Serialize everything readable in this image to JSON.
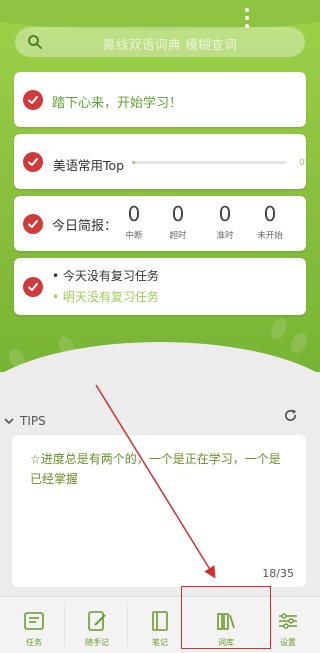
{
  "search": {
    "placeholder": "离线双语词典 模糊查词"
  },
  "cards": {
    "start": {
      "text": "踏下心来，开始学习！"
    },
    "progress": {
      "book": "美语常用Top",
      "percent_label": "0%",
      "progress": 0
    },
    "summary": {
      "title": "今日简报：",
      "stats": [
        {
          "value": "0",
          "label": "中断"
        },
        {
          "value": "0",
          "label": "超时"
        },
        {
          "value": "0",
          "label": "准时"
        },
        {
          "value": "0",
          "label": "未开始"
        }
      ]
    },
    "review": {
      "line1": "• 今天没有复习任务",
      "line2": "• 明天没有复习任务"
    }
  },
  "tips": {
    "header": "TIPS",
    "text": "☆进度总是有两个的，一个是正在学习，一个是已经掌握",
    "counter": "18/35"
  },
  "nav": {
    "items": [
      {
        "label": "任务",
        "icon": "task-icon"
      },
      {
        "label": "随手记",
        "icon": "quick-note-icon"
      },
      {
        "label": "笔记",
        "icon": "notebook-icon"
      },
      {
        "label": "词库",
        "icon": "word-library-icon"
      },
      {
        "label": "设置",
        "icon": "settings-icon"
      }
    ]
  },
  "colors": {
    "accent_green": "#8cc23f",
    "check_red": "#cf3b3b",
    "annotation_red": "#d23030"
  }
}
